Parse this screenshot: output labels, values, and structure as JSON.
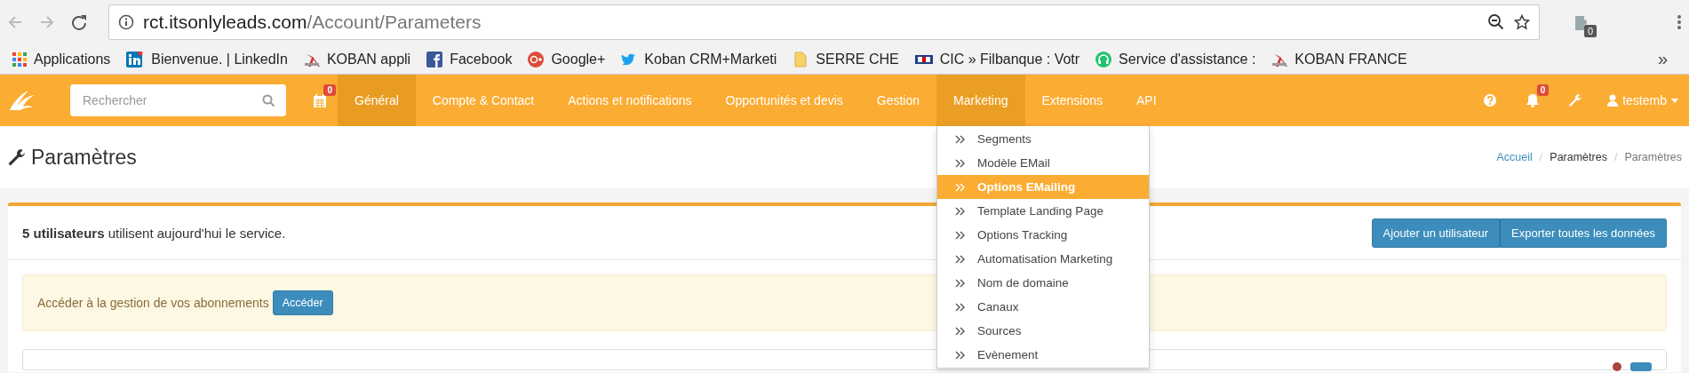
{
  "browser": {
    "address": {
      "host": "rct.itsonlyleads.com",
      "path": "/Account/Parameters"
    },
    "extension_badge": "0"
  },
  "bookmarks": [
    {
      "kind": "apps",
      "label": "Applications"
    },
    {
      "kind": "linkedin",
      "label": "Bienvenue. | LinkedIn"
    },
    {
      "kind": "koban",
      "label": "KOBAN appli"
    },
    {
      "kind": "facebook",
      "label": "Facebook"
    },
    {
      "kind": "google",
      "label": "Google+"
    },
    {
      "kind": "twitter",
      "label": "Koban CRM+Marketi"
    },
    {
      "kind": "file",
      "label": "SERRE CHE"
    },
    {
      "kind": "bank",
      "label": "CIC » Filbanque : Votr"
    },
    {
      "kind": "headset",
      "label": "Service d'assistance :"
    },
    {
      "kind": "koban",
      "label": "KOBAN FRANCE"
    }
  ],
  "bookmarks_overflow": "»",
  "app_nav": {
    "search": {
      "placeholder": "Rechercher"
    },
    "calendar_badge": "0",
    "menu": [
      {
        "label": "Général",
        "selected": true,
        "expanded": false
      },
      {
        "label": "Compte & Contact",
        "selected": false,
        "expanded": false
      },
      {
        "label": "Actions et notifications",
        "selected": false,
        "expanded": false
      },
      {
        "label": "Opportunités et devis",
        "selected": false,
        "expanded": false
      },
      {
        "label": "Gestion",
        "selected": false,
        "expanded": false
      },
      {
        "label": "Marketing",
        "selected": false,
        "expanded": true
      },
      {
        "label": "Extensions",
        "selected": false,
        "expanded": false
      },
      {
        "label": "API",
        "selected": false,
        "expanded": false
      }
    ],
    "notification_badge": "0",
    "user": "testemb"
  },
  "dropdown": [
    {
      "label": "Segments",
      "selected": false
    },
    {
      "label": "Modèle EMail",
      "selected": false
    },
    {
      "label": "Options EMailing",
      "selected": true
    },
    {
      "label": "Template Landing Page",
      "selected": false
    },
    {
      "label": "Options Tracking",
      "selected": false
    },
    {
      "label": "Automatisation Marketing",
      "selected": false
    },
    {
      "label": "Nom de domaine",
      "selected": false
    },
    {
      "label": "Canaux",
      "selected": false
    },
    {
      "label": "Sources",
      "selected": false
    },
    {
      "label": "Evènement",
      "selected": false
    }
  ],
  "page_header": {
    "title": "Paramètres",
    "breadcrumb": [
      {
        "label": "Accueil",
        "kind": "link"
      },
      {
        "label": "Paramètres",
        "kind": "item",
        "separator": "/"
      },
      {
        "label": "Paramètres",
        "kind": "active",
        "separator": "/"
      }
    ]
  },
  "summary": {
    "text": "**5 utilisateurs** utilisent aujourd'hui le service.",
    "buttons": [
      "Ajouter un utilisateur",
      "Exporter toutes les données"
    ]
  },
  "alert": {
    "text": "Accéder à la gestion de vos abonnements",
    "button": "Accéder"
  }
}
